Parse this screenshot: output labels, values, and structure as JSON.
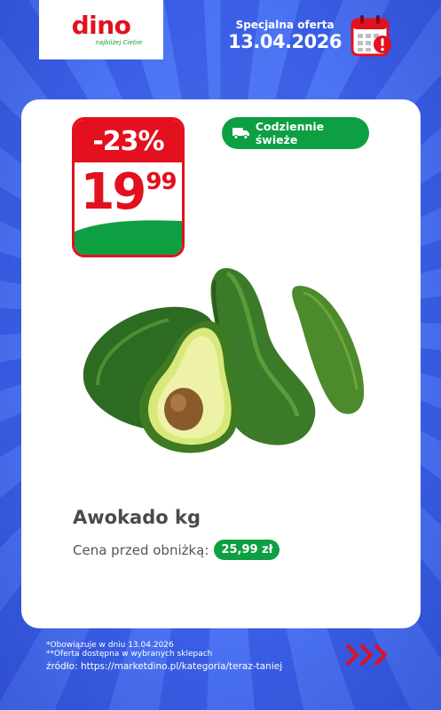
{
  "brand": {
    "logo_text": "dino",
    "tagline": "najbliżej Ciebie",
    "red": "#e3101e",
    "green": "#0e9f43",
    "blue": "#3d63ea"
  },
  "header": {
    "offer_label": "Specjalna oferta",
    "offer_date": "13.04.2026",
    "calendar_icon": "calendar-alert-icon"
  },
  "price_badge": {
    "discount": "-23%",
    "price_int": "19",
    "price_dec": "99"
  },
  "fresh_badge": {
    "icon": "delivery-truck-icon",
    "label": "Codziennie świeże"
  },
  "product": {
    "name": "Awokado kg",
    "image": "avocado-photo",
    "prev_price_label": "Cena przed obniżką:",
    "prev_price_value": "25,99 zł"
  },
  "footer": {
    "note1": "*Obowiązuje w dniu 13.04.2026",
    "note2": "**Oferta dostępna w wybranych sklepach",
    "source": "źródło: https://marketdino.pl/kategoria/teraz-taniej",
    "next_icon": "triple-chevron-right-icon"
  }
}
